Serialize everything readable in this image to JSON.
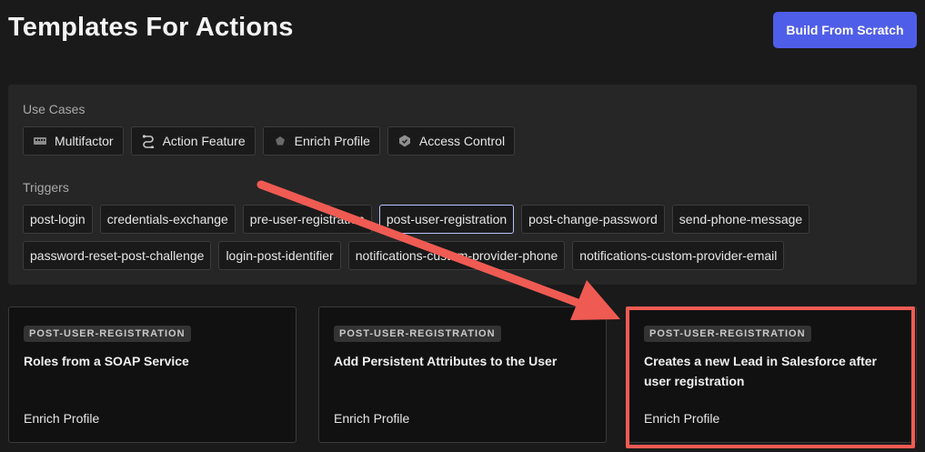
{
  "header": {
    "title": "Templates For Actions",
    "build_button": "Build From Scratch"
  },
  "filters": {
    "use_cases_label": "Use Cases",
    "use_cases": [
      {
        "label": "Multifactor",
        "icon": "keypad-icon"
      },
      {
        "label": "Action Feature",
        "icon": "flow-icon"
      },
      {
        "label": "Enrich Profile",
        "icon": "pentagon-icon"
      },
      {
        "label": "Access Control",
        "icon": "shield-icon"
      }
    ],
    "triggers_label": "Triggers",
    "triggers_row1": [
      "post-login",
      "credentials-exchange",
      "pre-user-registration",
      "post-user-registration",
      "post-change-password",
      "send-phone-message"
    ],
    "triggers_row2": [
      "password-reset-post-challenge",
      "login-post-identifier",
      "notifications-custom-provider-phone",
      "notifications-custom-provider-email"
    ],
    "selected_trigger": "post-user-registration"
  },
  "cards": [
    {
      "badge": "POST-USER-REGISTRATION",
      "title": "Roles from a SOAP Service",
      "category": "Enrich Profile"
    },
    {
      "badge": "POST-USER-REGISTRATION",
      "title": "Add Persistent Attributes to the User",
      "category": "Enrich Profile"
    },
    {
      "badge": "POST-USER-REGISTRATION",
      "title": "Creates a new Lead in Salesforce after user registration",
      "category": "Enrich Profile"
    }
  ],
  "colors": {
    "background": "#1a1a1a",
    "panel": "#262626",
    "accent_button": "#4f5ee8",
    "selected_border": "#b9c3ff",
    "annotation": "#ef5b53"
  }
}
